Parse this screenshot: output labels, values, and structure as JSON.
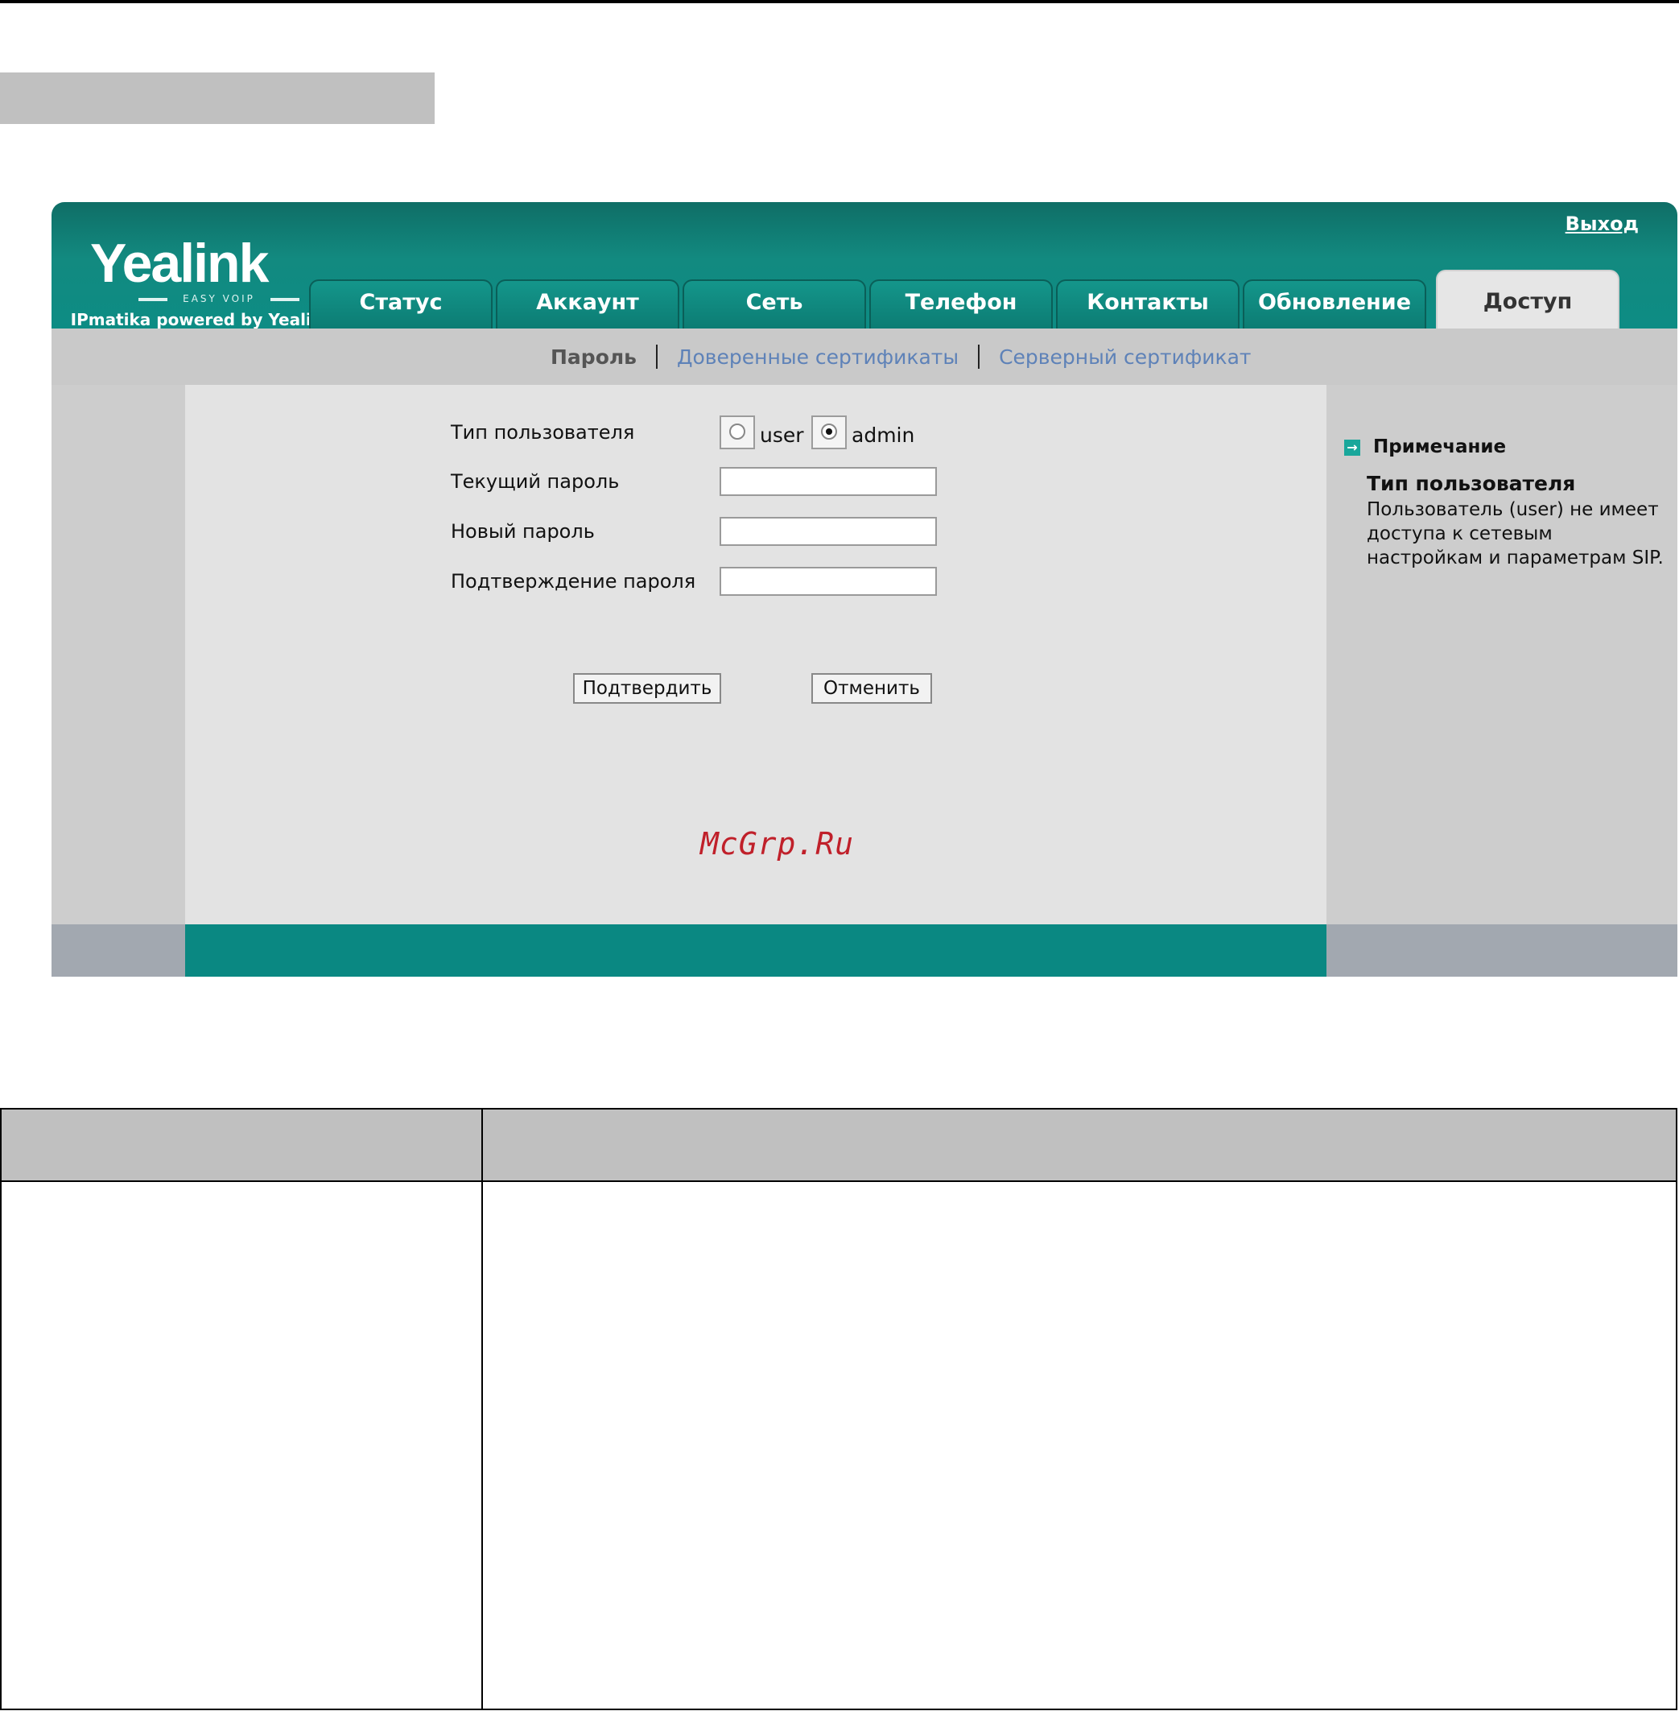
{
  "app": {
    "logo": "Yealink",
    "logo_sub": "EASY VOIP",
    "logo_tagline": "IPmatika powered by Yealink",
    "logout": "Выход"
  },
  "tabs": [
    {
      "label": "Статус"
    },
    {
      "label": "Аккаунт"
    },
    {
      "label": "Сеть"
    },
    {
      "label": "Телефон"
    },
    {
      "label": "Контакты"
    },
    {
      "label": "Обновление"
    },
    {
      "label": "Доступ",
      "active": true
    }
  ],
  "subnav": {
    "items": [
      "Пароль",
      "Доверенные сертификаты",
      "Серверный сертификат"
    ],
    "current": "Пароль"
  },
  "form": {
    "user_type_label": "Тип пользователя",
    "radio_user": "user",
    "radio_admin": "admin",
    "selected": "admin",
    "current_password_label": "Текущий пароль",
    "current_password_value": "",
    "new_password_label": "Новый пароль",
    "new_password_value": "",
    "confirm_password_label": "Подтверждение пароля",
    "confirm_password_value": "",
    "submit": "Подтвердить",
    "cancel": "Отменить"
  },
  "watermark": "McGrp.Ru",
  "note": {
    "title": "Примечание",
    "heading": "Тип пользователя",
    "body": "Пользователь (user) не имеет доступа к сетевым настройкам и параметрам SIP."
  },
  "colors": {
    "header_teal": "#128a80",
    "footer_teal": "#0a8882",
    "link_blue": "#5e82b8",
    "watermark_red": "#c0202a"
  }
}
